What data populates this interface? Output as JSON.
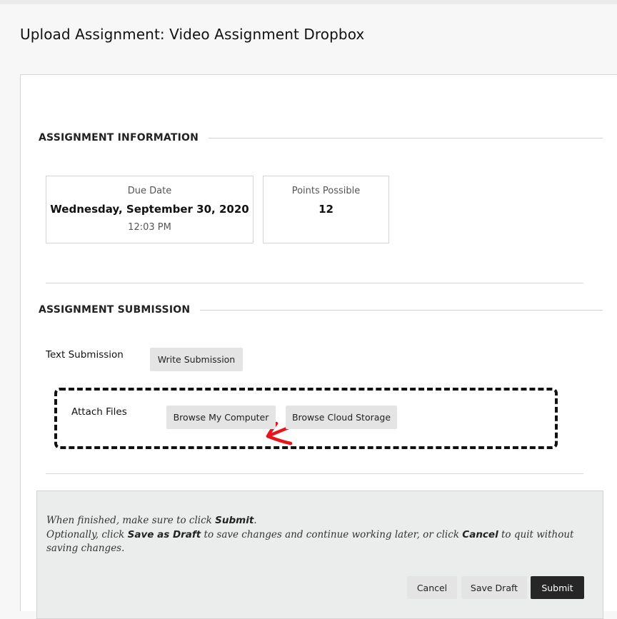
{
  "page": {
    "title": "Upload Assignment: Video Assignment Dropbox"
  },
  "assignment_information": {
    "heading": "ASSIGNMENT INFORMATION",
    "due_date": {
      "label": "Due Date",
      "date": "Wednesday, September 30, 2020",
      "time": "12:03 PM"
    },
    "points_possible": {
      "label": "Points Possible",
      "value": "12"
    }
  },
  "assignment_submission": {
    "heading": "ASSIGNMENT SUBMISSION",
    "text_submission": {
      "label": "Text Submission",
      "button_label": "Write Submission"
    },
    "attach_files": {
      "label": "Attach Files",
      "browse_computer_label": "Browse My Computer",
      "browse_cloud_label": "Browse Cloud Storage"
    }
  },
  "footer": {
    "line1_prefix": "When finished, make sure to click ",
    "line1_bold": "Submit",
    "line1_suffix": ".",
    "line2_a": "Optionally, click ",
    "line2_bold_save": "Save as Draft",
    "line2_b": " to save changes and continue working later, or click ",
    "line2_bold_cancel": "Cancel",
    "line2_c": " to quit without saving changes.",
    "cancel_label": "Cancel",
    "save_draft_label": "Save Draft",
    "submit_label": "Submit"
  },
  "annotations": {
    "arrow_color": "#e8141c",
    "dashed_box_color": "#111111"
  }
}
